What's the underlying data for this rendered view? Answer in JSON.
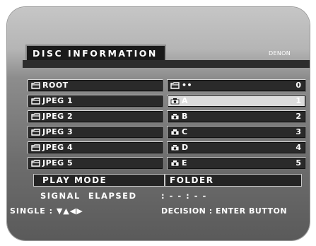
{
  "title": "DISC INFORMATION",
  "brand": "DENON",
  "folders": [
    {
      "label": "ROOT"
    },
    {
      "label": "JPEG 1"
    },
    {
      "label": "JPEG 2"
    },
    {
      "label": "JPEG 3"
    },
    {
      "label": "JPEG 4"
    },
    {
      "label": "JPEG 5"
    }
  ],
  "files": [
    {
      "label": "••",
      "index": "0",
      "icon": "folder-icon",
      "selected": false
    },
    {
      "label": "A",
      "index": "1",
      "icon": "camera-icon",
      "selected": true
    },
    {
      "label": "B",
      "index": "2",
      "icon": "camera-icon",
      "selected": false
    },
    {
      "label": "C",
      "index": "3",
      "icon": "camera-icon",
      "selected": false
    },
    {
      "label": "D",
      "index": "4",
      "icon": "camera-icon",
      "selected": false
    },
    {
      "label": "E",
      "index": "5",
      "icon": "camera-icon",
      "selected": false
    }
  ],
  "play_mode": {
    "label": "PLAY MODE",
    "value": "FOLDER"
  },
  "signal": {
    "label": "SIGNAL  ELAPSED",
    "value": ": - - : - -"
  },
  "footer": {
    "left": "SINGLE : ▼▲◀▶",
    "right": "DECISION : ENTER BUTTON"
  }
}
